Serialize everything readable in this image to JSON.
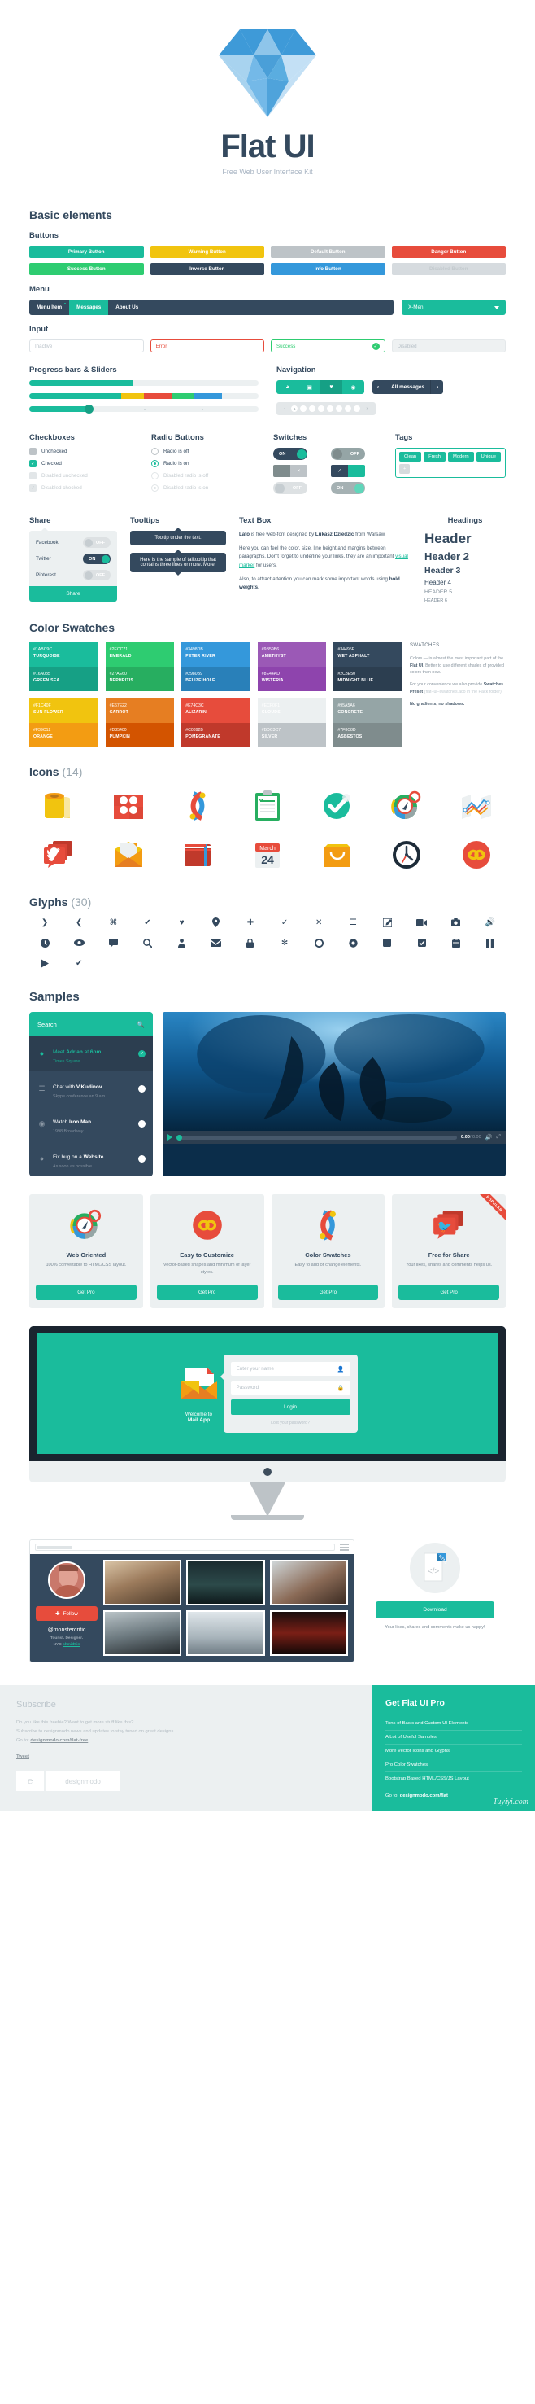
{
  "hero": {
    "title": "Flat UI",
    "subtitle": "Free Web User Interface Kit"
  },
  "sections": {
    "basic": "Basic elements",
    "buttons": "Buttons",
    "menu": "Menu",
    "input": "Input",
    "progress": "Progress bars & Sliders",
    "navigation": "Navigation",
    "checkboxes": "Checkboxes",
    "radio": "Radio Buttons",
    "switches": "Switches",
    "tags": "Tags",
    "share": "Share",
    "tooltips": "Tooltips",
    "textbox": "Text Box",
    "headings": "Headings",
    "swatches": "Color Swatches",
    "icons": "Icons",
    "icons_count": "(14)",
    "glyphs": "Glyphs",
    "glyphs_count": "(30)",
    "samples": "Samples"
  },
  "buttons": {
    "row1": [
      {
        "label": "Primary Button",
        "cls": "b-primary",
        "color": "#1abc9c"
      },
      {
        "label": "Warning Button",
        "cls": "b-warning",
        "color": "#f1c40f"
      },
      {
        "label": "Default Button",
        "cls": "b-default",
        "color": "#bdc3c7"
      },
      {
        "label": "Danger Button",
        "cls": "b-danger",
        "color": "#e74c3c"
      }
    ],
    "row2": [
      {
        "label": "Success Button",
        "cls": "b-success",
        "color": "#2ecc71"
      },
      {
        "label": "Inverse Button",
        "cls": "b-inverse",
        "color": "#34495e"
      },
      {
        "label": "Info Button",
        "cls": "b-info",
        "color": "#3498db"
      },
      {
        "label": "Disabled Button",
        "cls": "b-disabled",
        "color": "#d6dbdf"
      }
    ]
  },
  "menu": {
    "items": [
      {
        "label": "Menu Item",
        "active": false,
        "dot": true
      },
      {
        "label": "Messages",
        "active": true,
        "dot": false
      },
      {
        "label": "About Us",
        "active": false,
        "dot": false
      }
    ],
    "dropdown_value": "X-Men"
  },
  "inputs": [
    {
      "value": "Inactive",
      "state": ""
    },
    {
      "value": "Error",
      "state": "err"
    },
    {
      "value": "Success",
      "state": "suc"
    },
    {
      "value": "Disabled",
      "state": "dis"
    }
  ],
  "progress": {
    "bar1_pct": 45,
    "bar2_segments": [
      {
        "color": "#1abc9c",
        "pct": 40
      },
      {
        "color": "#f1c40f",
        "pct": 10
      },
      {
        "color": "#e74c3c",
        "pct": 12
      },
      {
        "color": "#2ecc71",
        "pct": 10
      },
      {
        "color": "#3498db",
        "pct": 12
      }
    ],
    "slider_pct": 26
  },
  "navigation": {
    "segments": [
      "clock-icon",
      "camera-icon",
      "heart-icon",
      "eye-icon"
    ],
    "active_index": 2,
    "messages_label": "All messages",
    "pager_pages": [
      "1",
      "",
      "",
      "",
      "",
      "",
      "",
      ""
    ],
    "pager_active": 0
  },
  "checkboxes": [
    {
      "label": "Unchecked",
      "checked": false,
      "disabled": false
    },
    {
      "label": "Checked",
      "checked": true,
      "disabled": false
    },
    {
      "label": "Disabled unchecked",
      "checked": false,
      "disabled": true
    },
    {
      "label": "Disabled checked",
      "checked": true,
      "disabled": true
    }
  ],
  "radios": [
    {
      "label": "Radio is off",
      "on": false,
      "disabled": false
    },
    {
      "label": "Radio is on",
      "on": true,
      "disabled": false
    },
    {
      "label": "Disabled radio is off",
      "on": false,
      "disabled": true
    },
    {
      "label": "Disabled radio is on",
      "on": true,
      "disabled": true
    }
  ],
  "switches": [
    {
      "label": "ON",
      "style": "on"
    },
    {
      "label": "OFF",
      "style": "off"
    },
    {
      "label": "×",
      "style": "sq1"
    },
    {
      "label": "✓",
      "style": "sq2"
    },
    {
      "label": "OFF",
      "style": "offl"
    },
    {
      "label": "ON",
      "style": "onl"
    }
  ],
  "tags": [
    "Clean",
    "Fresh",
    "Modern",
    "Unique"
  ],
  "tag_add": "+",
  "share": {
    "rows": [
      {
        "name": "Facebook",
        "state": "OFF",
        "on": false
      },
      {
        "name": "Twitter",
        "state": "ON",
        "on": true
      },
      {
        "name": "Pinterest",
        "state": "OFF",
        "on": false
      }
    ],
    "button": "Share"
  },
  "tooltips": [
    "Tooltip under the text.",
    "Here is the sample of talltooltip that contains three lines or more. More."
  ],
  "textbox": {
    "p1_pre": "Lato",
    "p1_mid": " is free web-font designed by ",
    "p1_b": "Lukasz Dziedzic",
    "p1_post": " from Warsaw.",
    "p2_a": "Here you can feel the color, size, line height and margins between paragraphs. Don't forget to underline your links, they are an important ",
    "p2_link": "visual marker",
    "p2_b": " for users.",
    "p3_a": "Also, to attract attention you can mark some important words using ",
    "p3_b": "bold weights",
    "p3_c": "."
  },
  "headings": [
    "Header",
    "Header 2",
    "Header 3",
    "Header 4",
    "HEADER 5",
    "HEADER 6"
  ],
  "swatches": {
    "columns": [
      [
        {
          "hex": "#1ABC9C",
          "name": "TURQUOISE",
          "bg": "#1abc9c"
        },
        {
          "hex": "#16A085",
          "name": "GREEN SEA",
          "bg": "#16a085"
        }
      ],
      [
        {
          "hex": "#2ECC71",
          "name": "EMERALD",
          "bg": "#2ecc71"
        },
        {
          "hex": "#27AE60",
          "name": "NEPHRITIS",
          "bg": "#27ae60"
        }
      ],
      [
        {
          "hex": "#3498DB",
          "name": "PETER RIVER",
          "bg": "#3498db"
        },
        {
          "hex": "#2980B9",
          "name": "BELIZE HOLE",
          "bg": "#2980b9"
        }
      ],
      [
        {
          "hex": "#9B59B6",
          "name": "AMETHYST",
          "bg": "#9b59b6"
        },
        {
          "hex": "#8E44AD",
          "name": "WISTERIA",
          "bg": "#8e44ad"
        }
      ],
      [
        {
          "hex": "#34495E",
          "name": "WET ASPHALT",
          "bg": "#34495e"
        },
        {
          "hex": "#2C3E50",
          "name": "MIDNIGHT BLUE",
          "bg": "#2c3e50"
        }
      ]
    ],
    "columns2": [
      [
        {
          "hex": "#F1C40F",
          "name": "SUN FLOWER",
          "bg": "#f1c40f"
        },
        {
          "hex": "#F39C12",
          "name": "ORANGE",
          "bg": "#f39c12"
        }
      ],
      [
        {
          "hex": "#E67E22",
          "name": "CARROT",
          "bg": "#e67e22"
        },
        {
          "hex": "#D35400",
          "name": "PUMPKIN",
          "bg": "#d35400"
        }
      ],
      [
        {
          "hex": "#E74C3C",
          "name": "ALIZARIN",
          "bg": "#e74c3c"
        },
        {
          "hex": "#C0392B",
          "name": "POMEGRANATE",
          "bg": "#c0392b"
        }
      ],
      [
        {
          "hex": "#ECF0F1",
          "name": "CLOUDS",
          "bg": "#ecf0f1"
        },
        {
          "hex": "#BDC3C7",
          "name": "SILVER",
          "bg": "#bdc3c7"
        }
      ],
      [
        {
          "hex": "#95A5A6",
          "name": "CONCRETE",
          "bg": "#95a5a6"
        },
        {
          "hex": "#7F8C8D",
          "name": "ASBESTOS",
          "bg": "#7f8c8d"
        }
      ]
    ],
    "note": {
      "title": "SWATCHES",
      "p1_a": "Colors — is almost the most important part of the ",
      "p1_b": "Flat UI",
      "p1_c": ". Better to use different shades of provided colors than new.",
      "p2_a": "For your convenience we also provide ",
      "p2_b": "Swatches Preset",
      "p2_c": " (flat–ui–swatches.aco in the Pack folder).",
      "p3": "No gradients, no shadows."
    }
  },
  "icons": [
    "toilet-paper-icon",
    "gift-box-icon",
    "refresh-cycle-icon",
    "clipboard-icon",
    "check-circle-icon",
    "compass-icon",
    "map-icon",
    "twitter-bubble-icon",
    "open-envelope-icon",
    "book-icon",
    "calendar-icon",
    "shopping-bag-icon",
    "clock-icon",
    "infinity-icon"
  ],
  "calendar": {
    "month": "March",
    "day": "24"
  },
  "glyphs": [
    "chevron-right-icon",
    "chevron-left-icon",
    "command-icon",
    "check-circle-icon",
    "heart-icon",
    "location-pin-icon",
    "plus-icon",
    "check-icon",
    "close-icon",
    "list-icon",
    "edit-icon",
    "video-camera-icon",
    "camera-icon",
    "volume-icon",
    "clock-icon",
    "eye-icon",
    "comment-icon",
    "search-icon",
    "user-icon",
    "envelope-icon",
    "lock-icon",
    "gear-icon",
    "circle-outline-icon",
    "record-icon",
    "square-icon",
    "checkbox-icon",
    "calendar-icon",
    "pause-icon",
    "play-icon",
    "check-badge-icon"
  ],
  "tasklist": {
    "search_placeholder": "Search",
    "items": [
      {
        "icon": "user-icon",
        "title_a": "Meet ",
        "title_b": "Adrian",
        "title_c": " at ",
        "title_d": "6pm",
        "sub": "Times Square",
        "done": true,
        "active": true
      },
      {
        "icon": "list-icon",
        "title_a": "Chat with ",
        "title_b": "V.Kudinov",
        "title_c": "",
        "title_d": "",
        "sub": "Skype conference an 9 am",
        "done": false,
        "active": false
      },
      {
        "icon": "eye-icon",
        "title_a": "Watch ",
        "title_b": "Iron Man",
        "title_c": "",
        "title_d": "",
        "sub": "1998 Broadway",
        "done": false,
        "active": false
      },
      {
        "icon": "clock-icon",
        "title_a": "Fix bug on a ",
        "title_b": "Website",
        "title_c": "",
        "title_d": "",
        "sub": "As soon as possible",
        "done": false,
        "active": false
      }
    ]
  },
  "video": {
    "current": "0:00",
    "duration": "/ 0:00"
  },
  "cards": [
    {
      "icon": "compass-icon",
      "title": "Web Oriented",
      "desc": "100% convertable to HTML/CSS layout.",
      "button": "Get Pro",
      "ribbon": ""
    },
    {
      "icon": "infinity-icon",
      "title": "Easy to Customize",
      "desc": "Vector-based shapes and minimum of layer styles.",
      "button": "Get Pro",
      "ribbon": ""
    },
    {
      "icon": "refresh-cycle-icon",
      "title": "Color Swatches",
      "desc": "Easy to add or change elements.",
      "button": "Get Pro",
      "ribbon": ""
    },
    {
      "icon": "twitter-bubble-icon",
      "title": "Free for Share",
      "desc": "Your likes, shares and comments helps us.",
      "button": "Get Pro",
      "ribbon": "POPULAR"
    }
  ],
  "login": {
    "welcome": "Welcome to",
    "app": "Mail App",
    "name_placeholder": "Enter your name",
    "password_placeholder": "Password",
    "button": "Login",
    "lost": "Lost your password?"
  },
  "gallery": {
    "handle": "@monstercritic",
    "bio_a": "Tourist. Designer.",
    "bio_b": "NYC ",
    "bio_link": "shmidt.in",
    "follow": "Follow",
    "download": "Download",
    "download_note": "Your likes, shares and comments make us happy!",
    "html_badge": "HTML",
    "code_glyph": "</>"
  },
  "footer": {
    "subscribe_title": "Subscribe",
    "line1": "Do you like this freebie? Want to get more stuff like this?",
    "line2": "Subscribe to designmodo news and updates to stay tuned on great designs.",
    "goto_label": "Go to: ",
    "goto_link": "designmodo.com/flat-free",
    "tweet": "Tweet",
    "logo_text": "designmodo",
    "pro_title": "Get Flat UI Pro",
    "pro_items": [
      "Tons of Basic and Custom UI Elements",
      "A Lot of Useful Samples",
      "More Vector Icons and Glyphs",
      "Pro Color Swatches",
      "Bootstrap Based HTML/CSS/JS Layout"
    ],
    "pro_goto_label": "Go to: ",
    "pro_goto_link": "designmodo.com/flat",
    "watermark": "Tuyiyi.com"
  }
}
